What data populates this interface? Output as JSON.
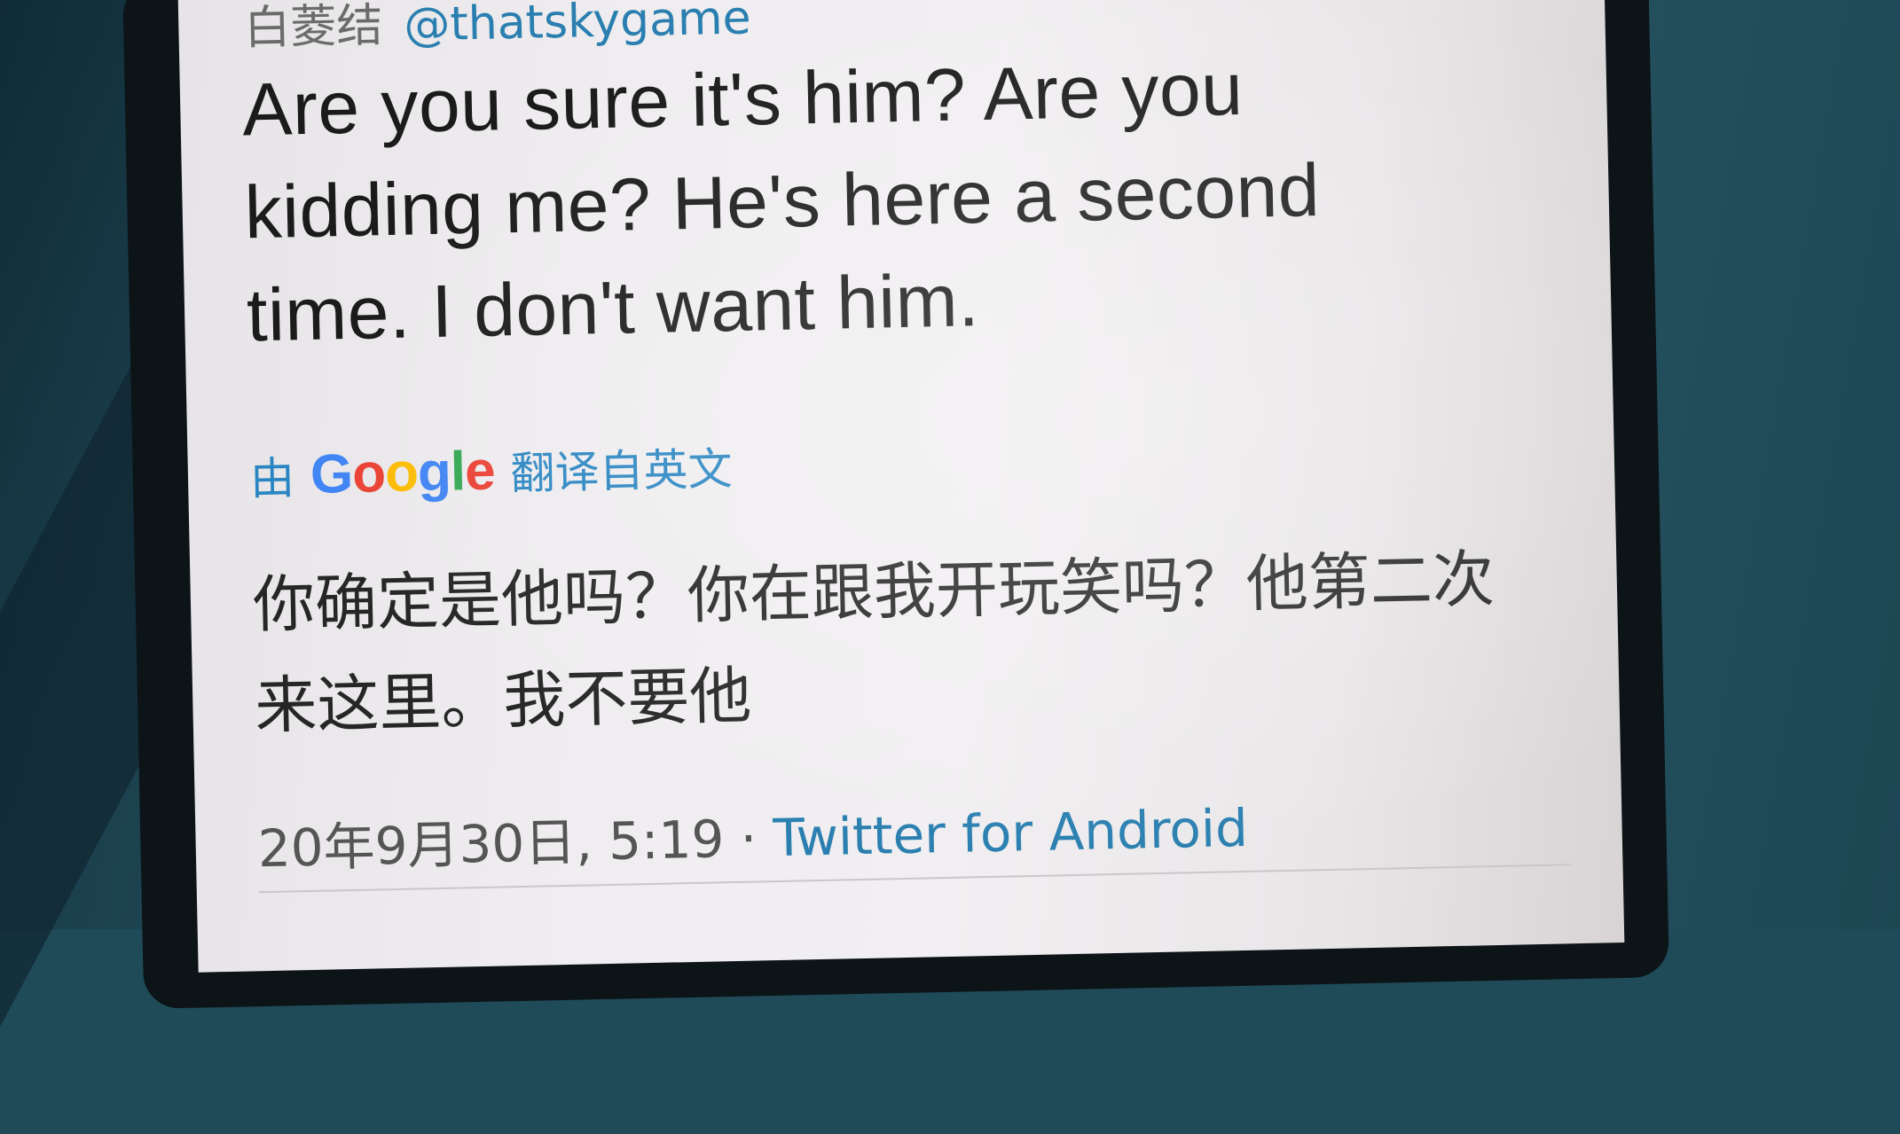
{
  "tweet": {
    "author_name": "白菱结",
    "handle": "@thatskygame",
    "text": "Are you sure it's him? Are you kidding me? He's here a second time. I don't want him.",
    "translation_prefix": "由",
    "translation_provider": "Google",
    "translation_suffix": "翻译自英文",
    "translated_text": "你确定是他吗？你在跟我开玩笑吗？他第二次来这里。我不要他",
    "timestamp": "20年9月30日, 5:19 ·",
    "source": "Twitter for Android"
  },
  "colors": {
    "link": "#2a7fb0",
    "text": "#1b1b1b",
    "google_blue": "#4285f4",
    "google_red": "#ea4335",
    "google_yellow": "#fbbc05",
    "google_green": "#34a853"
  }
}
